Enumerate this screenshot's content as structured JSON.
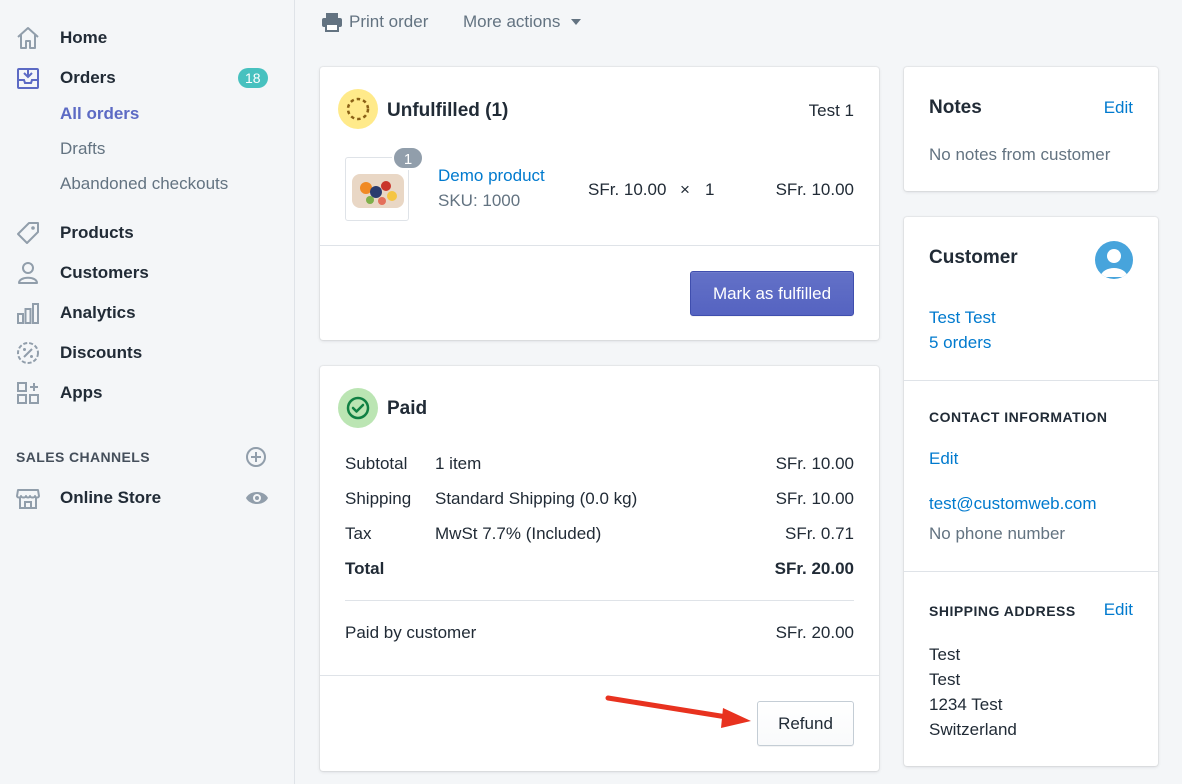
{
  "sidebar": {
    "items": [
      {
        "label": "Home",
        "icon": "home-icon"
      },
      {
        "label": "Orders",
        "icon": "orders-icon",
        "badge": "18"
      },
      {
        "label": "Products",
        "icon": "tag-icon"
      },
      {
        "label": "Customers",
        "icon": "person-icon"
      },
      {
        "label": "Analytics",
        "icon": "bar-chart-icon"
      },
      {
        "label": "Discounts",
        "icon": "discount-icon"
      },
      {
        "label": "Apps",
        "icon": "apps-icon"
      }
    ],
    "orders_sub": [
      {
        "label": "All orders",
        "active": true
      },
      {
        "label": "Drafts"
      },
      {
        "label": "Abandoned checkouts"
      }
    ],
    "sales_channels_heading": "SALES CHANNELS",
    "online_store": "Online Store"
  },
  "top_actions": {
    "print": "Print order",
    "more": "More actions"
  },
  "fulfillment": {
    "title": "Unfulfilled (1)",
    "location": "Test 1",
    "product": {
      "name": "Demo product",
      "sku": "SKU: 1000",
      "price": "SFr. 10.00",
      "times": "×",
      "qty": "1",
      "total": "SFr. 10.00",
      "badge_qty": "1"
    },
    "button": "Mark as fulfilled"
  },
  "payment": {
    "title": "Paid",
    "rows": [
      {
        "label": "Subtotal",
        "desc": "1 item",
        "amount": "SFr. 10.00"
      },
      {
        "label": "Shipping",
        "desc": "Standard Shipping (0.0 kg)",
        "amount": "SFr. 10.00"
      },
      {
        "label": "Tax",
        "desc": "MwSt 7.7% (Included)",
        "amount": "SFr. 0.71"
      },
      {
        "label": "Total",
        "desc": "",
        "amount": "SFr. 20.00"
      }
    ],
    "paid_by_label": "Paid by customer",
    "paid_by_amount": "SFr. 20.00",
    "button": "Refund"
  },
  "notes": {
    "title": "Notes",
    "edit": "Edit",
    "text": "No notes from customer"
  },
  "customer": {
    "title": "Customer",
    "name": "Test Test",
    "orders": "5 orders",
    "contact_heading": "CONTACT INFORMATION",
    "contact_edit": "Edit",
    "email": "test@customweb.com",
    "phone": "No phone number",
    "shipping_heading": "SHIPPING ADDRESS",
    "shipping_edit": "Edit",
    "address": [
      "Test",
      "Test",
      "1234 Test",
      "Switzerland"
    ]
  },
  "colors": {
    "accent": "#5c6ac4",
    "link": "#007ace",
    "unfulfilled": "#ffea8a",
    "paid": "#bbe5b3",
    "annotation_arrow": "#e8321f"
  }
}
